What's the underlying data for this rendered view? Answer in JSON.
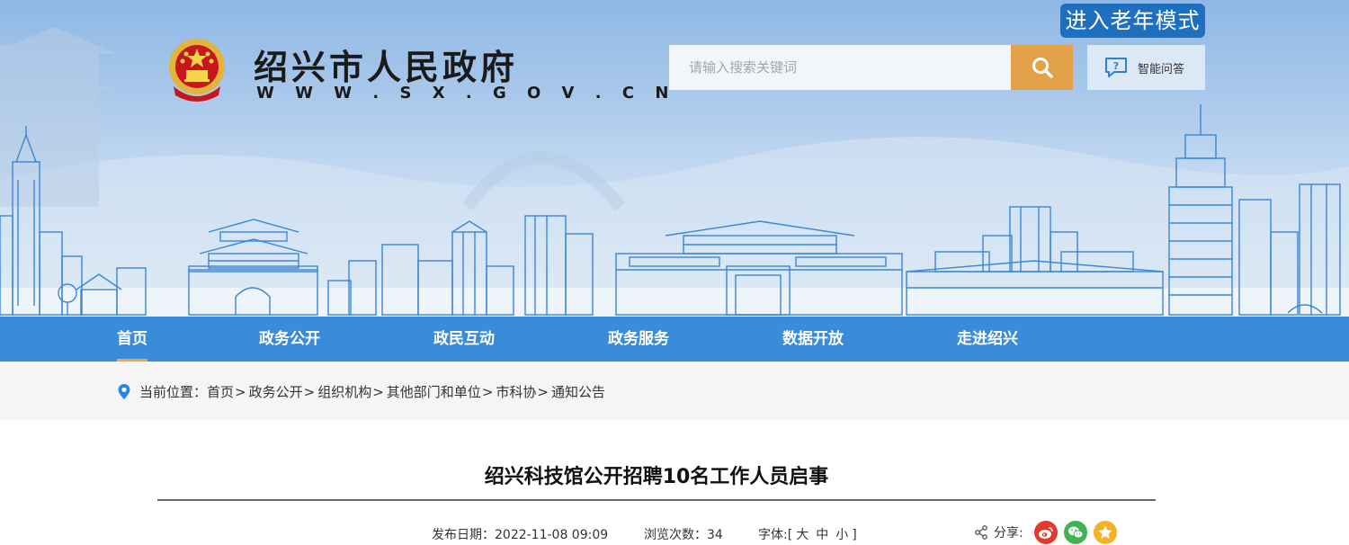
{
  "header": {
    "elder_mode_label": "进入老年模式",
    "site_title": "绍兴市人民政府",
    "site_url": "W W W . S X . G O V . C N",
    "search_placeholder": "请输入搜索关键词",
    "qa_label": "智能问答"
  },
  "nav": {
    "items": [
      {
        "label": "首页",
        "active": true
      },
      {
        "label": "政务公开"
      },
      {
        "label": "政民互动"
      },
      {
        "label": "政务服务"
      },
      {
        "label": "数据开放"
      },
      {
        "label": "走进绍兴"
      }
    ]
  },
  "breadcrumb": {
    "prefix": "当前位置：",
    "items": [
      "首页",
      "政务公开",
      "组织机构",
      "其他部门和单位",
      "市科协",
      "通知公告"
    ],
    "separator": ">"
  },
  "article": {
    "title": "绍兴科技馆公开招聘10名工作人员启事",
    "publish_label": "发布日期：",
    "publish_date": "2022-11-08 09:09",
    "views_label": "浏览次数：",
    "views": "34",
    "font_label": "字体:[",
    "font_large": "大",
    "font_medium": "中",
    "font_small": "小",
    "font_close": "]",
    "share_label": "分享:"
  },
  "colors": {
    "nav_bg": "#3a8bd8",
    "accent_orange": "#e3a249",
    "elder_btn": "#1f6fbf",
    "weibo": "#e6392d",
    "wechat": "#3fb34f",
    "qzone": "#f4b324"
  }
}
